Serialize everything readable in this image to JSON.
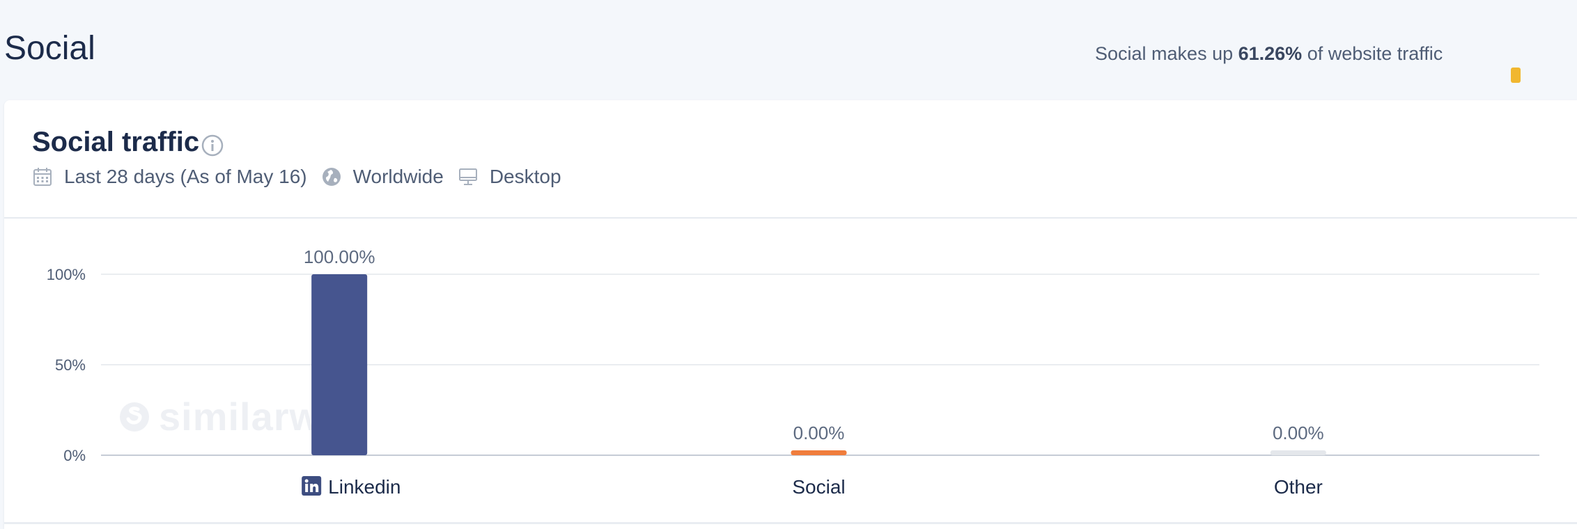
{
  "page": {
    "title": "Social",
    "share_prefix": "Social makes up ",
    "share_value": "61.26%",
    "share_suffix": " of website traffic"
  },
  "card": {
    "title": "Social traffic",
    "period": "Last 28 days (As of May 16)",
    "region": "Worldwide",
    "device": "Desktop"
  },
  "watermark": "similarweb",
  "icons": {
    "info": "info-icon",
    "calendar": "calendar-icon",
    "globe": "globe-icon",
    "desktop": "desktop-icon",
    "linkedin": "linkedin-icon"
  },
  "chart_data": {
    "type": "bar",
    "categories": [
      "Linkedin",
      "Social",
      "Other"
    ],
    "values": [
      100,
      0,
      0
    ],
    "value_labels": [
      "100.00%",
      "0.00%",
      "0.00%"
    ],
    "colors": [
      "#46558f",
      "#f07d3c",
      "#e4e7eb"
    ],
    "yticks": [
      "0%",
      "50%",
      "100%"
    ],
    "ylim": [
      0,
      100
    ],
    "grid": true,
    "title": "",
    "xlabel": "",
    "ylabel": ""
  }
}
